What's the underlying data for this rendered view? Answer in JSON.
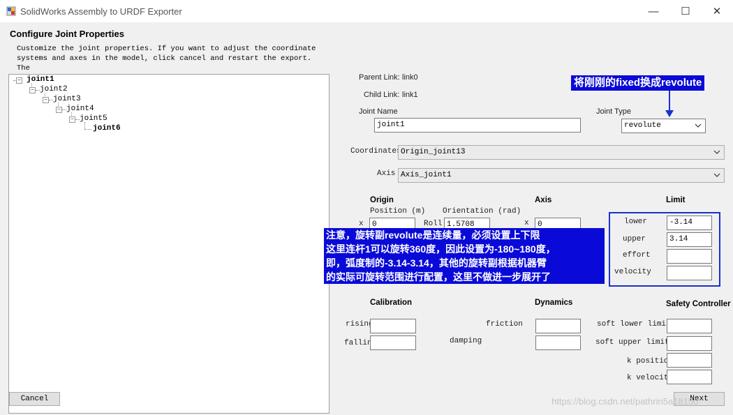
{
  "window": {
    "title": "SolidWorks Assembly to URDF Exporter",
    "minimize_glyph": "—",
    "maximize_glyph": "☐",
    "close_glyph": "✕"
  },
  "page": {
    "heading": "Configure Joint Properties",
    "description": "Customize the joint properties. If you want to adjust the coordinate\nsystems and axes in the model, click cancel and restart the export. The\ntool will recognize your changes on the next run."
  },
  "tree": {
    "nodes": [
      {
        "label": "joint1",
        "bold": true
      },
      {
        "label": "joint2",
        "bold": false
      },
      {
        "label": "joint3",
        "bold": false
      },
      {
        "label": "joint4",
        "bold": false
      },
      {
        "label": "joint5",
        "bold": false
      },
      {
        "label": "joint6",
        "bold": true
      }
    ]
  },
  "buttons": {
    "cancel": "Cancel",
    "next": "Next"
  },
  "links": {
    "parent_label": "Parent Link:",
    "parent_value": "link0",
    "child_label": "Child Link:",
    "child_value": "link1"
  },
  "joint": {
    "name_label": "Joint Name",
    "name_value": "joint1",
    "type_label": "Joint Type",
    "type_value": "revolute"
  },
  "coordinates": {
    "label": "Coordinates",
    "value": "Origin_joint13"
  },
  "axis_select": {
    "label": "Axis",
    "value": "Axis_joint1"
  },
  "origin": {
    "title": "Origin",
    "position_label": "Position (m)",
    "orientation_label": "Orientation (rad)",
    "x_label": "x",
    "x_value": "0",
    "roll_label": "Roll",
    "roll_value": "1.5708"
  },
  "axis": {
    "title": "Axis",
    "x_label": "x",
    "x_value": "0"
  },
  "limit": {
    "title": "Limit",
    "lower_label": "lower",
    "lower_value": "-3.14",
    "upper_label": "upper",
    "upper_value": "3.14",
    "effort_label": "effort",
    "effort_value": "",
    "velocity_label": "velocity",
    "velocity_value": ""
  },
  "calibration": {
    "title": "Calibration",
    "rising_label": "rising",
    "falling_label": "falling"
  },
  "dynamics": {
    "title": "Dynamics",
    "friction_label": "friction",
    "damping_label": "damping"
  },
  "safety": {
    "title": "Safety Controller",
    "soft_lower_label": "soft lower limit",
    "soft_upper_label": "soft upper limit",
    "k_position_label": "k position",
    "k_velocity_label": "k velocity"
  },
  "annotations": {
    "top": "将刚刚的fixed换成revolute",
    "middle": [
      "注意，旋转副revolute是连续量，必须设置上下限",
      "这里连杆1可以旋转360度，因此设置为-180~180度，",
      "即，弧度制的-3.14-3.14，其他的旋转副根据机器臂",
      "的实际可旋转范围进行配置，这里不做进一步展开了"
    ]
  },
  "watermark": "https://blog.csdn.net/pathrin5a18150",
  "colors": {
    "annotation_bg": "#0a0ad8",
    "limit_border": "#1a2fd0"
  }
}
